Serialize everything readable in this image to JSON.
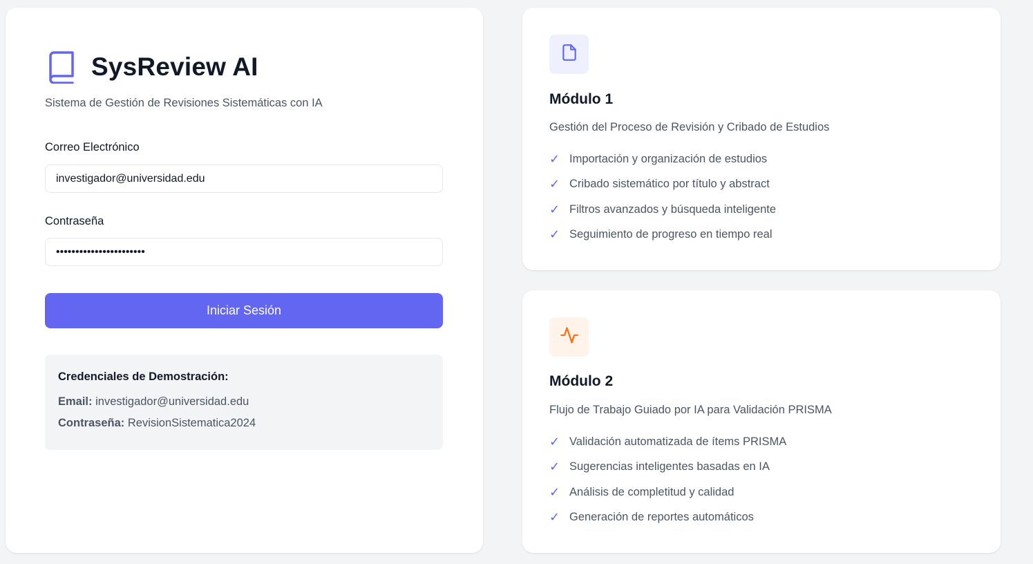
{
  "login": {
    "brand_title": "SysReview AI",
    "subtitle": "Sistema de Gestión de Revisiones Sistemáticas con IA",
    "email_label": "Correo Electrónico",
    "email_value": "investigador@universidad.edu",
    "password_label": "Contraseña",
    "password_value": "RevisionSistematica2024",
    "submit_label": "Iniciar Sesión",
    "demo": {
      "title": "Credenciales de Demostración:",
      "email_key": "Email:",
      "email_value": "investigador@universidad.edu",
      "password_key": "Contraseña:",
      "password_value": "RevisionSistematica2024"
    }
  },
  "modules": [
    {
      "icon": "document-icon",
      "icon_color": "#6366f1",
      "icon_bg": "#eef0fd",
      "title": "Módulo 1",
      "description": "Gestión del Proceso de Revisión y Cribado de Estudios",
      "features": [
        "Importación y organización de estudios",
        "Cribado sistemático por título y abstract",
        "Filtros avanzados y búsqueda inteligente",
        "Seguimiento de progreso en tiempo real"
      ]
    },
    {
      "icon": "activity-icon",
      "icon_color": "#f97316",
      "icon_bg": "#fff3ea",
      "title": "Módulo 2",
      "description": "Flujo de Trabajo Guiado por IA para Validación PRISMA",
      "features": [
        "Validación automatizada de ítems PRISMA",
        "Sugerencias inteligentes basadas en IA",
        "Análisis de completitud y calidad",
        "Generación de reportes automáticos"
      ]
    }
  ],
  "check_glyph": "✓",
  "accent_color": "#6366f1"
}
